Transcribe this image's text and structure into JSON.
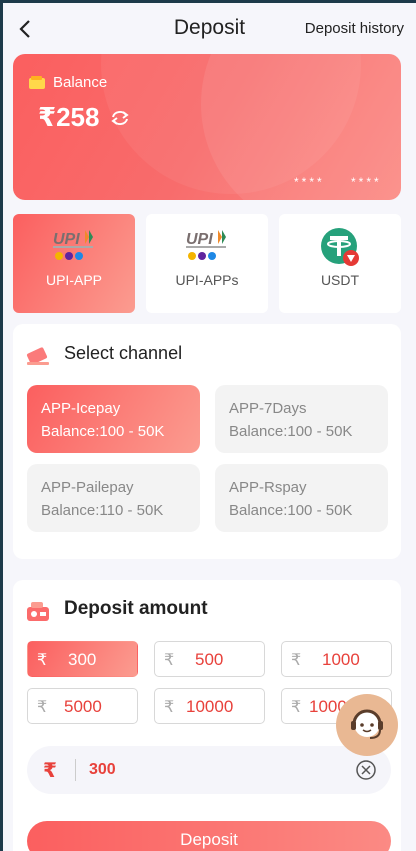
{
  "header": {
    "title": "Deposit",
    "history_label": "Deposit history"
  },
  "balance": {
    "label": "Balance",
    "amount": "₹258",
    "mask_left": "****",
    "mask_right": "****"
  },
  "methods": [
    {
      "label": "UPI-APP",
      "icon": "upi-logo",
      "active": true
    },
    {
      "label": "UPI-APPs",
      "icon": "upi-logo",
      "active": false
    },
    {
      "label": "USDT",
      "icon": "tether-logo",
      "active": false
    }
  ],
  "channel_section": {
    "title": "Select channel",
    "channels": [
      {
        "name": "APP-Icepay",
        "range": "Balance:100 - 50K",
        "active": true
      },
      {
        "name": "APP-7Days",
        "range": "Balance:100 - 50K",
        "active": false
      },
      {
        "name": "APP-Pailepay",
        "range": "Balance:110 - 50K",
        "active": false
      },
      {
        "name": "APP-Rspay",
        "range": "Balance:100 - 50K",
        "active": false
      }
    ]
  },
  "amount_section": {
    "title": "Deposit amount",
    "currency_symbol": "₹",
    "presets": [
      "300",
      "500",
      "1000",
      "5000",
      "10000",
      "100000"
    ],
    "selected_preset": "300",
    "input_value": "300",
    "submit_label": "Deposit"
  },
  "colors": {
    "accent": "#fb5f5f",
    "accent_light": "#fb9c90",
    "amount_text": "#e8413b",
    "support": "#e9b893"
  }
}
